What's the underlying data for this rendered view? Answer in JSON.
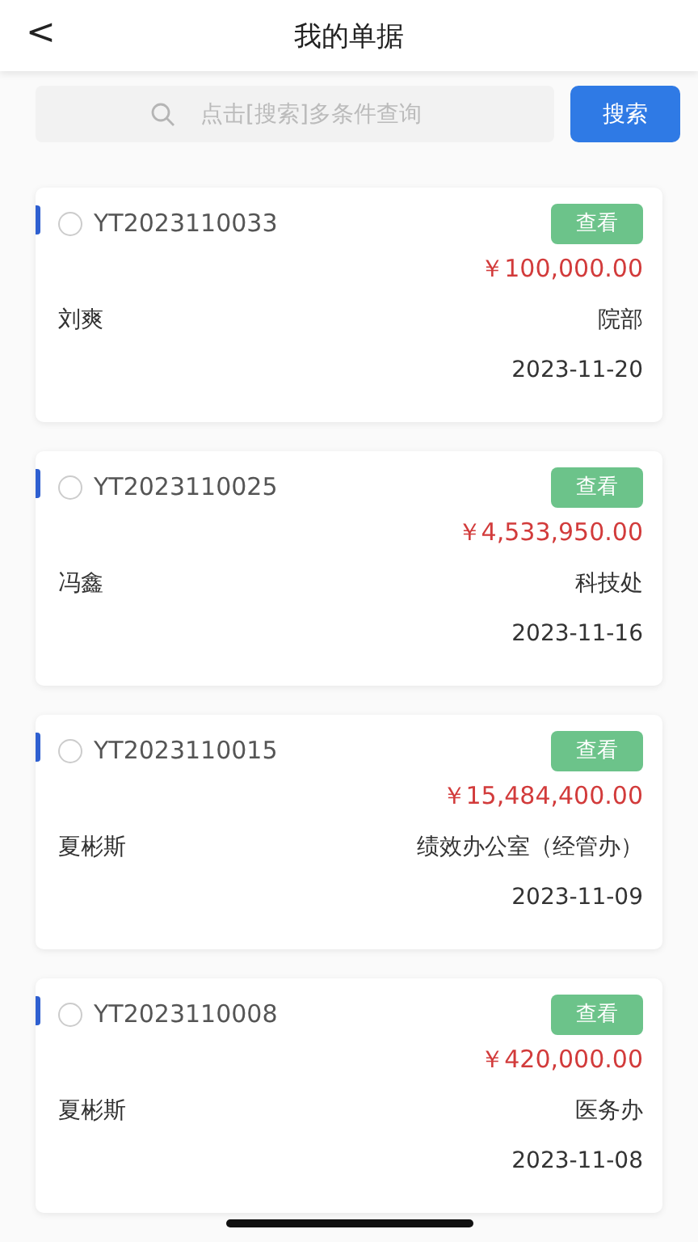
{
  "header": {
    "back": "<",
    "title": "我的单据"
  },
  "search": {
    "placeholder": "点击[搜索]多条件查询",
    "button": "搜索"
  },
  "documents": [
    {
      "number": "YT2023110033",
      "selected": false,
      "action": "查看",
      "amount": "￥100,000.00",
      "person": "刘爽",
      "department": "院部",
      "date": "2023-11-20"
    },
    {
      "number": "YT2023110025",
      "selected": false,
      "action": "查看",
      "amount": "￥4,533,950.00",
      "person": "冯鑫",
      "department": "科技处",
      "date": "2023-11-16"
    },
    {
      "number": "YT2023110015",
      "selected": false,
      "action": "查看",
      "amount": "￥15,484,400.00",
      "person": "夏彬斯",
      "department": "绩效办公室（经管办）",
      "date": "2023-11-09"
    },
    {
      "number": "YT2023110008",
      "selected": false,
      "action": "查看",
      "amount": "￥420,000.00",
      "person": "夏彬斯",
      "department": "医务办",
      "date": "2023-11-08"
    }
  ]
}
